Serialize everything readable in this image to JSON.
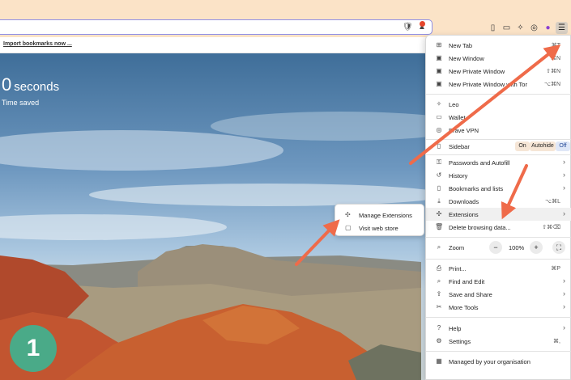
{
  "bookmarks_bar": {
    "import_link": "Import bookmarks now ..."
  },
  "new_tab": {
    "stat_value": "0",
    "stat_unit": "seconds",
    "stat_label": "Time saved"
  },
  "step_badge": "1",
  "menu": {
    "group1": [
      {
        "icon": "new-tab-icon",
        "glyph": "⊞",
        "label": "New Tab",
        "shortcut": "⌘T"
      },
      {
        "icon": "new-window-icon",
        "glyph": "▣",
        "label": "New Window",
        "shortcut": "⌘N"
      },
      {
        "icon": "private-window-icon",
        "glyph": "▣",
        "label": "New Private Window",
        "shortcut": "⇧⌘N"
      },
      {
        "icon": "tor-window-icon",
        "glyph": "▣",
        "label": "New Private Window with Tor",
        "shortcut": "⌥⌘N"
      }
    ],
    "group2": [
      {
        "icon": "leo-icon",
        "glyph": "✧",
        "label": "Leo"
      },
      {
        "icon": "wallet-icon",
        "glyph": "▭",
        "label": "Wallet"
      },
      {
        "icon": "vpn-icon",
        "glyph": "◎",
        "label": "Brave VPN"
      }
    ],
    "sidebar": {
      "label": "Sidebar",
      "on": "On",
      "autohide": "Autohide",
      "off": "Off"
    },
    "group3": [
      {
        "icon": "key-icon",
        "glyph": "⚿",
        "label": "Passwords and Autofill",
        "chevron": "›"
      },
      {
        "icon": "history-icon",
        "glyph": "↺",
        "label": "History",
        "chevron": "›"
      },
      {
        "icon": "bookmarks-icon",
        "glyph": "▯",
        "label": "Bookmarks and lists",
        "chevron": "›"
      },
      {
        "icon": "download-icon",
        "glyph": "⤓",
        "label": "Downloads",
        "shortcut": "⌥⌘L"
      },
      {
        "icon": "extensions-icon",
        "glyph": "✣",
        "label": "Extensions",
        "chevron": "›"
      },
      {
        "icon": "delete-icon",
        "glyph": "🗑",
        "label": "Delete browsing data...",
        "shortcut": "⇧⌘⌫"
      }
    ],
    "zoom": {
      "label": "Zoom",
      "minus": "−",
      "value": "100%",
      "plus": "+",
      "fullscreen": "⛶"
    },
    "group4": [
      {
        "icon": "print-icon",
        "glyph": "⎙",
        "label": "Print...",
        "shortcut": "⌘P"
      },
      {
        "icon": "find-icon",
        "glyph": "⌕",
        "label": "Find and Edit",
        "chevron": "›"
      },
      {
        "icon": "save-icon",
        "glyph": "⇪",
        "label": "Save and Share",
        "chevron": "›"
      },
      {
        "icon": "tools-icon",
        "glyph": "✂",
        "label": "More Tools",
        "chevron": "›"
      }
    ],
    "group5": [
      {
        "icon": "help-icon",
        "glyph": "?",
        "label": "Help",
        "chevron": "›"
      },
      {
        "icon": "settings-icon",
        "glyph": "⚙",
        "label": "Settings",
        "shortcut": "⌘,"
      }
    ],
    "managed": {
      "icon": "building-icon",
      "glyph": "▦",
      "label": "Managed by your organisation"
    }
  },
  "submenu": [
    {
      "icon": "manage-extensions-icon",
      "glyph": "✣",
      "label": "Manage Extensions"
    },
    {
      "icon": "web-store-icon",
      "glyph": "▢",
      "label": "Visit web store"
    }
  ],
  "colors": {
    "accent_arrow": "#ef6b4a",
    "badge": "#4aaa88",
    "url_border": "#8f8fe6"
  }
}
